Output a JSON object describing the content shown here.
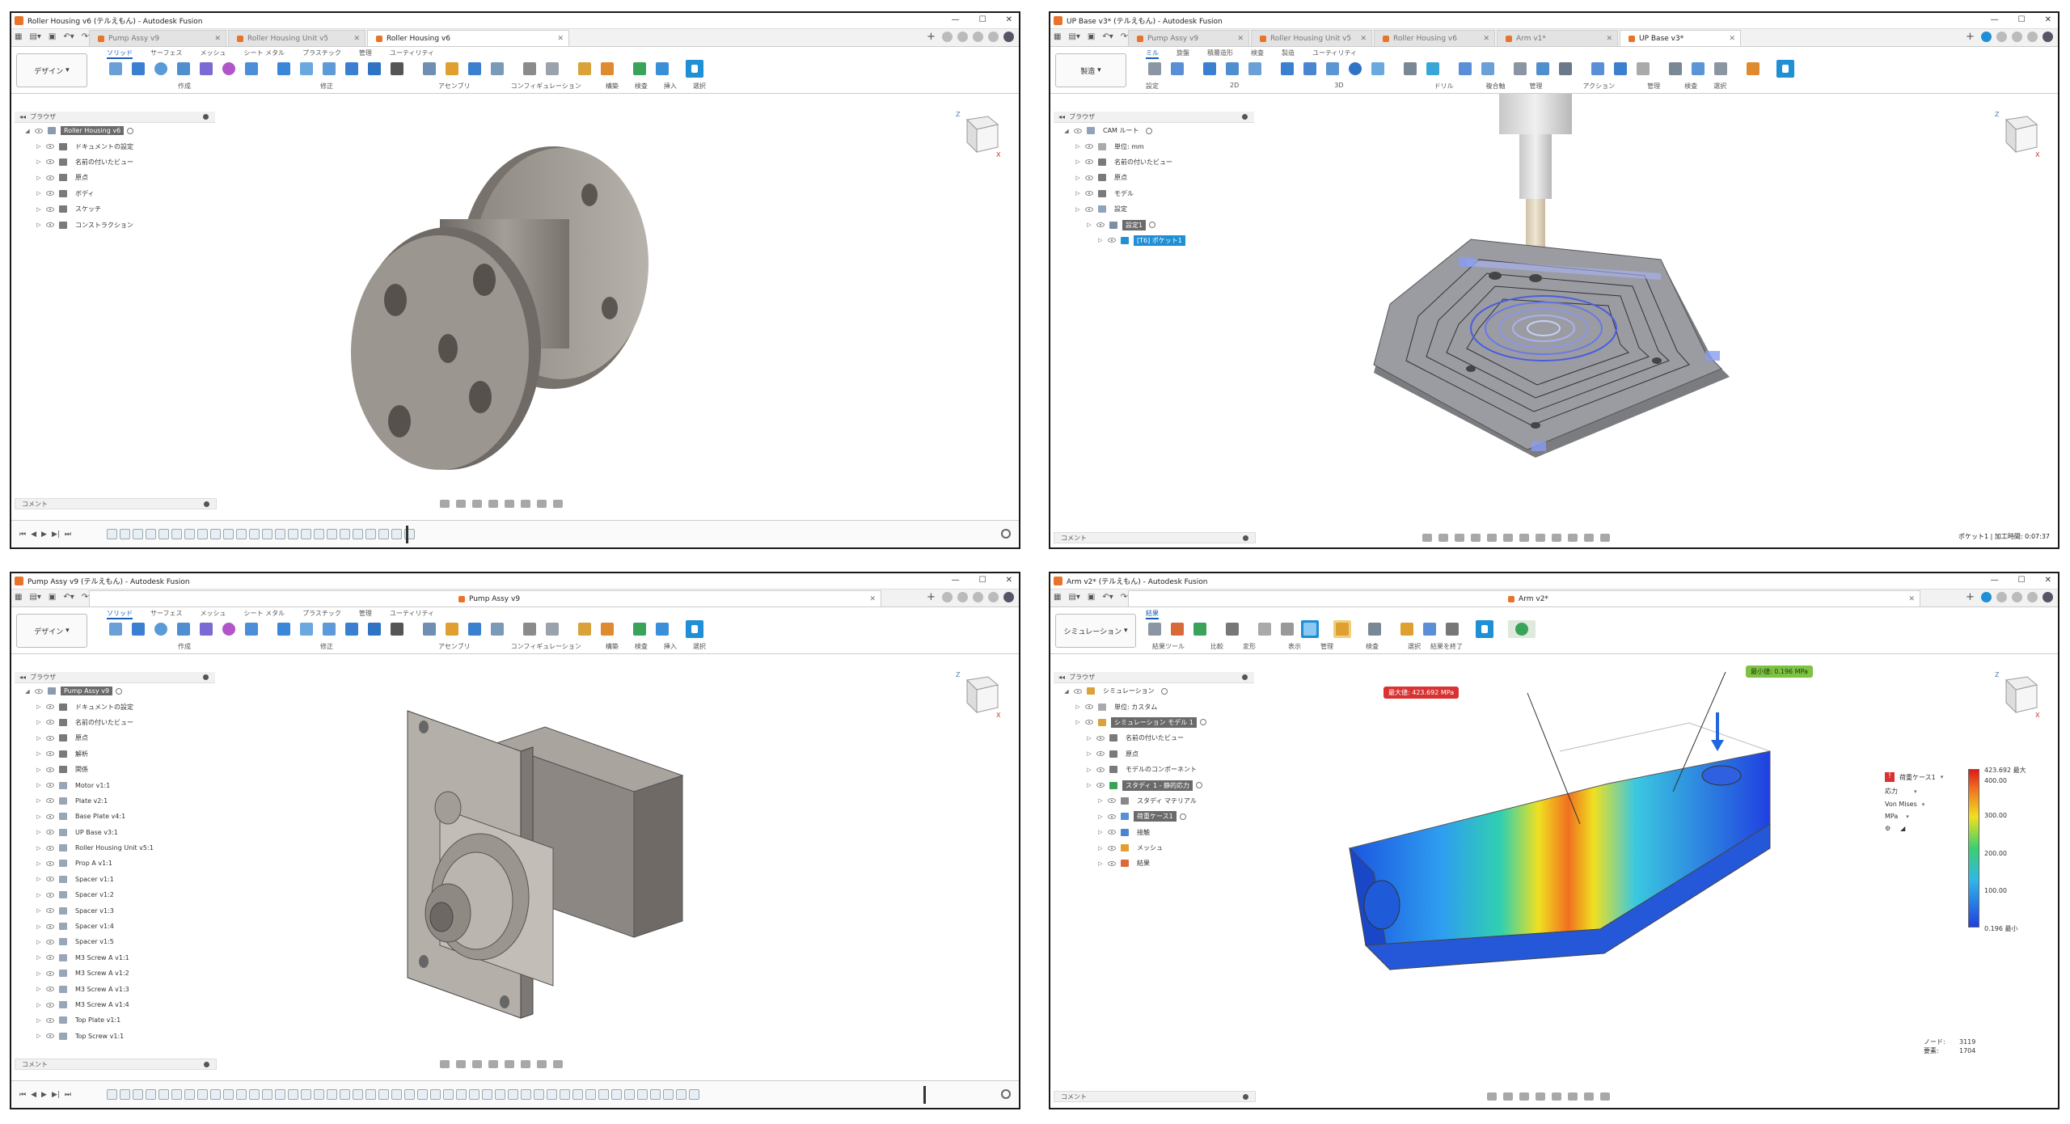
{
  "windows": [
    {
      "title": "Roller Housing v6 (テルえもん) - Autodesk Fusion",
      "tabs": [
        {
          "label": "Pump Assy v9",
          "active": false
        },
        {
          "label": "Roller Housing Unit v5",
          "active": false
        },
        {
          "label": "Roller Housing v6",
          "active": true
        }
      ],
      "workspace": "デザイン",
      "ribbon_tabs": [
        "ソリッド",
        "サーフェス",
        "メッシュ",
        "シート メタル",
        "プラスチック",
        "管理",
        "ユーティリティ"
      ],
      "active_ribbon_tab": "ソリッド",
      "ribbon_groups": [
        "作成",
        "修正",
        "アセンブリ",
        "コンフィギュレーション",
        "構築",
        "検査",
        "挿入",
        "選択"
      ],
      "browser_title": "ブラウザ",
      "browser": [
        {
          "label": "Roller Housing v6",
          "level": 0,
          "style": "hl",
          "icon": "component"
        },
        {
          "label": "ドキュメントの設定",
          "level": 1,
          "icon": "gear"
        },
        {
          "label": "名前の付いたビュー",
          "level": 1,
          "icon": "folder"
        },
        {
          "label": "原点",
          "level": 1,
          "icon": "folder"
        },
        {
          "label": "ボディ",
          "level": 1,
          "icon": "folder"
        },
        {
          "label": "スケッチ",
          "level": 1,
          "icon": "folder"
        },
        {
          "label": "コンストラクション",
          "level": 1,
          "icon": "folder"
        }
      ],
      "comment_label": "コメント"
    },
    {
      "title": "UP Base v3* (テルえもん) - Autodesk Fusion",
      "tabs": [
        {
          "label": "Pump Assy v9",
          "active": false
        },
        {
          "label": "Roller Housing Unit v5",
          "active": false
        },
        {
          "label": "Roller Housing v6",
          "active": false
        },
        {
          "label": "Arm v1*",
          "active": false
        },
        {
          "label": "UP Base v3*",
          "active": true
        }
      ],
      "workspace": "製造",
      "ribbon_tabs": [
        "ミル",
        "旋盤",
        "積層造形",
        "検査",
        "製造",
        "ユーティリティ"
      ],
      "active_ribbon_tab": "ミル",
      "ribbon_groups": [
        "設定",
        "2D",
        "3D",
        "ドリル",
        "複合軸",
        "管理",
        "アクション",
        "管理",
        "検査",
        "選択"
      ],
      "browser_title": "ブラウザ",
      "browser": [
        {
          "label": "CAM ルート",
          "level": 0,
          "icon": "cam"
        },
        {
          "label": "単位: mm",
          "level": 1,
          "icon": "doc"
        },
        {
          "label": "名前の付いたビュー",
          "level": 1,
          "icon": "folder"
        },
        {
          "label": "原点",
          "level": 1,
          "icon": "folder"
        },
        {
          "label": "モデル",
          "level": 1,
          "icon": "folder"
        },
        {
          "label": "設定",
          "level": 1,
          "icon": "cam"
        },
        {
          "label": "設定1",
          "level": 2,
          "style": "hl",
          "icon": "setup"
        },
        {
          "label": "[T6] ポケット1",
          "level": 3,
          "style": "sel",
          "icon": "op"
        }
      ],
      "comment_label": "コメント",
      "status": "ポケット1 | 加工時間: 0:07:37"
    },
    {
      "title": "Pump Assy v9 (テルえもん) - Autodesk Fusion",
      "tabs": [
        {
          "label": "Pump Assy v9",
          "active": true
        }
      ],
      "workspace": "デザイン",
      "ribbon_tabs": [
        "ソリッド",
        "サーフェス",
        "メッシュ",
        "シート メタル",
        "プラスチック",
        "管理",
        "ユーティリティ"
      ],
      "active_ribbon_tab": "ソリッド",
      "ribbon_groups": [
        "作成",
        "修正",
        "アセンブリ",
        "コンフィギュレーション",
        "構築",
        "検査",
        "挿入",
        "選択"
      ],
      "browser_title": "ブラウザ",
      "browser": [
        {
          "label": "Pump Assy v9",
          "level": 0,
          "style": "hl",
          "icon": "component"
        },
        {
          "label": "ドキュメントの設定",
          "level": 1,
          "icon": "gear"
        },
        {
          "label": "名前の付いたビュー",
          "level": 1,
          "icon": "folder"
        },
        {
          "label": "原点",
          "level": 1,
          "icon": "folder"
        },
        {
          "label": "解析",
          "level": 1,
          "icon": "folder"
        },
        {
          "label": "関係",
          "level": 1,
          "icon": "folder"
        },
        {
          "label": "Motor v1:1",
          "level": 1,
          "icon": "part"
        },
        {
          "label": "Plate v2:1",
          "level": 1,
          "icon": "part"
        },
        {
          "label": "Base Plate v4:1",
          "level": 1,
          "icon": "part"
        },
        {
          "label": "UP Base v3:1",
          "level": 1,
          "icon": "part"
        },
        {
          "label": "Roller Housing Unit v5:1",
          "level": 1,
          "icon": "part"
        },
        {
          "label": "Prop A v1:1",
          "level": 1,
          "icon": "part"
        },
        {
          "label": "Spacer v1:1",
          "level": 1,
          "icon": "part"
        },
        {
          "label": "Spacer v1:2",
          "level": 1,
          "icon": "part"
        },
        {
          "label": "Spacer v1:3",
          "level": 1,
          "icon": "part"
        },
        {
          "label": "Spacer v1:4",
          "level": 1,
          "icon": "part"
        },
        {
          "label": "Spacer v1:5",
          "level": 1,
          "icon": "part"
        },
        {
          "label": "M3 Screw A v1:1",
          "level": 1,
          "icon": "part"
        },
        {
          "label": "M3 Screw A v1:2",
          "level": 1,
          "icon": "part"
        },
        {
          "label": "M3 Screw A v1:3",
          "level": 1,
          "icon": "part"
        },
        {
          "label": "M3 Screw A v1:4",
          "level": 1,
          "icon": "part"
        },
        {
          "label": "Top Plate v1:1",
          "level": 1,
          "icon": "part"
        },
        {
          "label": "Top Screw v1:1",
          "level": 1,
          "icon": "part"
        }
      ],
      "comment_label": "コメント"
    },
    {
      "title": "Arm v2* (テルえもん) - Autodesk Fusion",
      "tabs": [
        {
          "label": "Arm v2*",
          "active": true
        }
      ],
      "workspace": "シミュレーション",
      "ribbon_tabs": [
        "結果"
      ],
      "active_ribbon_tab": "結果",
      "ribbon_groups": [
        "結果ツール",
        "比較",
        "変形",
        "表示",
        "管理",
        "検査",
        "選択",
        "結果を終了"
      ],
      "browser_title": "ブラウザ",
      "browser": [
        {
          "label": "シミュレーション",
          "level": 0,
          "icon": "sim"
        },
        {
          "label": "単位: カスタム",
          "level": 1,
          "icon": "doc"
        },
        {
          "label": "シミュレーション モデル 1",
          "level": 1,
          "style": "hl",
          "icon": "sim"
        },
        {
          "label": "名前の付いたビュー",
          "level": 2,
          "icon": "folder"
        },
        {
          "label": "原点",
          "level": 2,
          "icon": "folder"
        },
        {
          "label": "モデルのコンポーネント",
          "level": 2,
          "icon": "folder"
        },
        {
          "label": "スタディ 1 - 静的応力",
          "level": 2,
          "style": "hl",
          "icon": "check"
        },
        {
          "label": "スタディ マテリアル",
          "level": 3,
          "icon": "mat"
        },
        {
          "label": "荷重ケース1",
          "level": 3,
          "style": "hl",
          "icon": "load"
        },
        {
          "label": "接触",
          "level": 3,
          "icon": "contact"
        },
        {
          "label": "メッシュ",
          "level": 3,
          "icon": "mesh"
        },
        {
          "label": "結果",
          "level": 3,
          "icon": "result"
        }
      ],
      "comment_label": "コメント",
      "callout_max": "最大値: 423.692 MPa",
      "callout_min": "最小値: 0.196 MPa",
      "legend": {
        "case": "荷重ケース1",
        "result": "応力",
        "type": "Von Mises",
        "unit": "MPa",
        "ticks": [
          "423.692 最大",
          "400.00",
          "300.00",
          "200.00",
          "100.00",
          "0.196 最小"
        ],
        "tick_values": [
          423.692,
          400,
          300,
          200,
          100,
          0.196
        ],
        "nodes_label": "ノード:",
        "nodes_value": "3119",
        "elements_label": "要素:",
        "elements_value": "1704"
      }
    }
  ],
  "colors": {
    "accent": "#1f8fd6",
    "fusion_orange": "#e8732a",
    "metal": "#8a857f",
    "callout_max": "#d93232",
    "callout_min": "#7dc242"
  }
}
